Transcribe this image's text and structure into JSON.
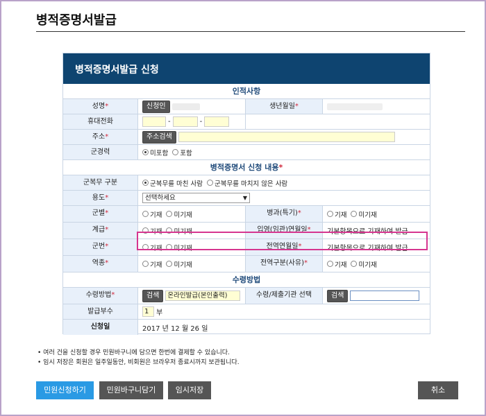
{
  "page_title": "병적증명서발급",
  "form_header": "병적증명서발급 신청",
  "sections": {
    "personal": "인적사항",
    "request": "병적증명서 신청 내용",
    "request_req": "*",
    "receipt": "수령방법"
  },
  "personal": {
    "name_label": "성명",
    "name_button": "신청인",
    "dob_label": "생년월일",
    "phone_label": "휴대전화",
    "phone_sep1": "-",
    "phone_sep2": "-",
    "address_label": "주소",
    "address_button": "주소검색",
    "military_label": "군경력",
    "military_opt1": "미포함",
    "military_opt2": "포함"
  },
  "request": {
    "service_type_label": "군복무 구분",
    "service_opt1": "군복무를 마친 사람",
    "service_opt2": "군복무를 마치지 않은 사람",
    "purpose_label": "용도",
    "purpose_value": "선택하세요",
    "branch_label": "군별",
    "specialty_label": "병과(특기)",
    "rank_label": "계급",
    "enlist_label": "입영(임관)연월일",
    "enlist_value": "기본항목으로 기재하여 발급",
    "serial_label": "군번",
    "discharge_label": "전역연월일",
    "discharge_value": "기본항목으로 기재하여 발급",
    "service_kind_label": "역종",
    "discharge_reason_label": "전역구분(사유)",
    "opt_yes": "기재",
    "opt_no": "미기재"
  },
  "receipt": {
    "method_label": "수령방법",
    "search_button": "검색",
    "method_value": "온라인발급(본인출력)",
    "agency_label": "수령/제출기관 선택",
    "agency_button": "검색",
    "copies_label": "발급부수",
    "copies_value": "1",
    "copies_unit": "부",
    "date_label": "신청일",
    "date_value": "2017 년 12 월 26 일"
  },
  "required_mark": "*",
  "notes": [
    "여러 건을 신청할 경우 민원바구니에 담으면 한번에 결제할 수 있습니다.",
    "임시 저장은 회원은 일주일동안, 비회원은 브라우저 종료시까지 보관됩니다."
  ],
  "buttons": {
    "apply": "민원신청하기",
    "cart": "민원바구니담기",
    "temp_save": "임시저장",
    "cancel": "취소"
  },
  "colors": {
    "header_bg": "#0e4470",
    "label_bg": "#e8f0fa",
    "highlight": "#d6358f",
    "apply_button": "#2a9ae4"
  }
}
